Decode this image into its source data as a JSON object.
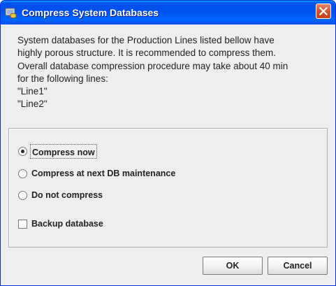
{
  "window": {
    "title": "Compress System Databases",
    "icon": "database-icon",
    "close_icon": "close-icon"
  },
  "message": {
    "lines": [
      "System databases for the Production Lines listed bellow have",
      "highly porous structure. It is recommended to compress them.",
      "Overall database compression procedure may take about 40 min",
      "for the following lines:",
      "\"Line1\"",
      "\"Line2\""
    ]
  },
  "options": {
    "compress_now": {
      "label": "Compress now",
      "selected": true
    },
    "compress_next": {
      "label": "Compress at next DB maintenance",
      "selected": false
    },
    "do_not_compress": {
      "label": "Do not compress",
      "selected": false
    },
    "backup": {
      "label": "Backup database",
      "checked": false
    }
  },
  "buttons": {
    "ok": "OK",
    "cancel": "Cancel"
  },
  "colors": {
    "titlebar": "#0053ee",
    "close_button": "#d6512b",
    "dialog_background": "#eeeeee"
  }
}
